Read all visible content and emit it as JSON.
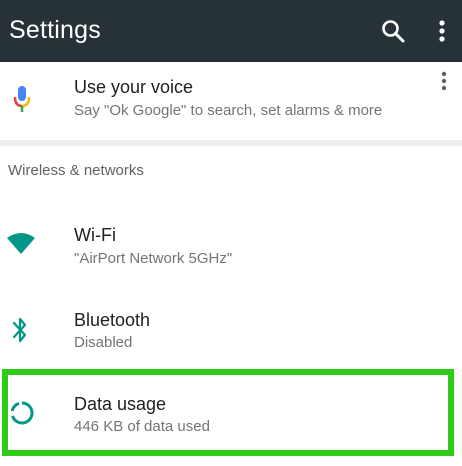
{
  "app_bar": {
    "title": "Settings",
    "search_icon": "search-icon",
    "more_icon": "more-vert-icon",
    "background": "#263238"
  },
  "voice_card": {
    "title": "Use your voice",
    "subtitle": "Say \"Ok Google\" to search, set alarms & more",
    "icon": "google-mic-icon",
    "more_icon": "more-vert-icon"
  },
  "section": {
    "header": "Wireless & networks",
    "items": [
      {
        "title": "Wi-Fi",
        "subtitle": "\"AirPort Network 5GHz\"",
        "icon": "wifi-icon"
      },
      {
        "title": "Bluetooth",
        "subtitle": "Disabled",
        "icon": "bluetooth-icon"
      },
      {
        "title": "Data usage",
        "subtitle": "446 KB of data used",
        "icon": "data-usage-icon",
        "highlighted": true
      }
    ]
  },
  "colors": {
    "accent_teal": "#009688",
    "highlight_green": "#2ecc17"
  }
}
